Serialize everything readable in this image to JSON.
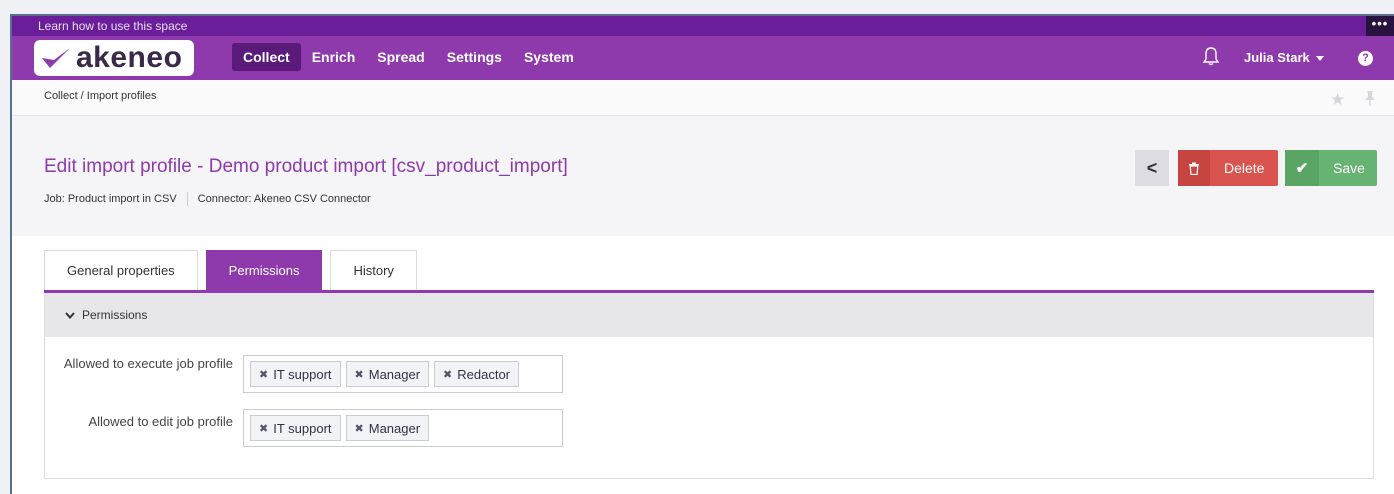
{
  "topstrip": {
    "learn": "Learn how to use this space",
    "more": "•••"
  },
  "brand": {
    "name": "akeneo"
  },
  "nav": {
    "items": [
      "Collect",
      "Enrich",
      "Spread",
      "Settings",
      "System"
    ],
    "active_index": 0,
    "user": "Julia Stark",
    "help": "?"
  },
  "breadcrumb": "Collect / Import profiles",
  "page": {
    "title": "Edit import profile - Demo product import [csv_product_import]",
    "job": "Job: Product import in CSV",
    "connector": "Connector: Akeneo CSV Connector"
  },
  "actions": {
    "back": "<",
    "delete": "Delete",
    "save": "Save"
  },
  "tabs": [
    "General properties",
    "Permissions",
    "History"
  ],
  "active_tab": 1,
  "section": {
    "title": "Permissions"
  },
  "fields": [
    {
      "label": "Allowed to execute job profile",
      "tags": [
        "IT support",
        "Manager",
        "Redactor"
      ]
    },
    {
      "label": "Allowed to edit job profile",
      "tags": [
        "IT support",
        "Manager"
      ]
    }
  ],
  "colors": {
    "brand": "#8e3aac",
    "delete": "#d9534f",
    "save": "#67b373"
  },
  "icons": {
    "chip_remove": "✖",
    "delete": "trash-icon",
    "save": "check-icon"
  }
}
